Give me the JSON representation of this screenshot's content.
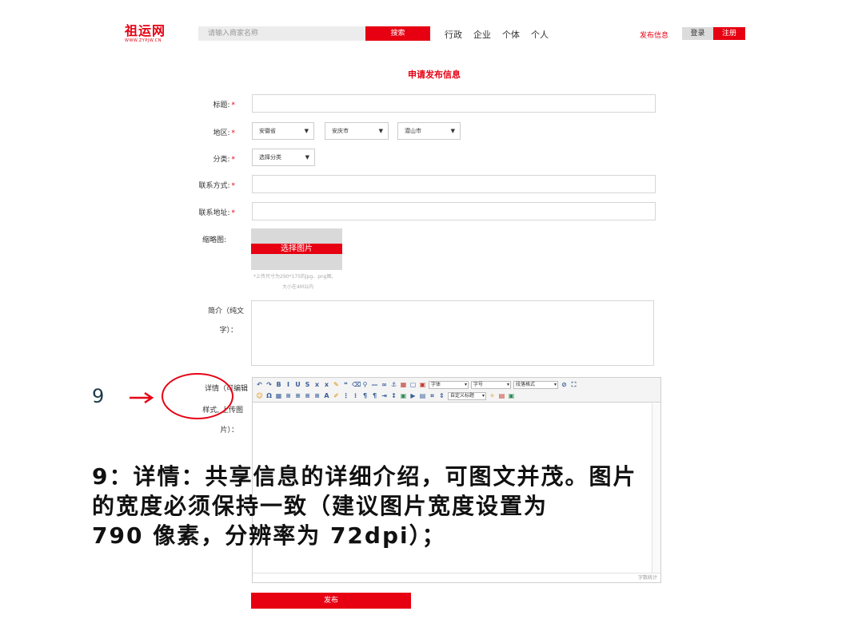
{
  "header": {
    "logo_title": "祖运网",
    "logo_url": "WWW.ZYPJW.CN",
    "search_placeholder": "请输入商家名称",
    "search_button": "搜索",
    "nav": [
      "行政",
      "企业",
      "个体",
      "个人"
    ],
    "publish_link": "发布信息",
    "login": "登录",
    "register": "注册"
  },
  "page_title": "申请发布信息",
  "form": {
    "title_label": "标题:",
    "region_label": "地区:",
    "region_province": "安徽省",
    "region_city": "安庆市",
    "region_county": "潜山市",
    "category_label": "分类:",
    "category_value": "选择分类",
    "contact_label": "联系方式:",
    "address_label": "联系地址:",
    "thumbnail_label": "缩略图:",
    "thumbnail_button": "选择图片",
    "thumbnail_hint_1": "*上传尺寸为290*175的jpg、png图,",
    "thumbnail_hint_2": "大小在4M以内",
    "summary_label_1": "简介（纯文",
    "summary_label_2": "字）：",
    "detail_label_1": "详情（可编辑",
    "detail_label_2": "样式, 上传图",
    "detail_label_3": "片）：",
    "required_mark": "*",
    "submit": "发布"
  },
  "editor": {
    "font_family": "字体",
    "font_size": "字号",
    "paragraph": "段落格式",
    "custom_title": "自定义标题",
    "word_count": "字数统计"
  },
  "annotation": {
    "number": "9",
    "caption_lines": [
      "9：详情：共享信息的详细介绍，可图文并茂。图片",
      "的宽度必须保持一致（建议图片宽度设置为",
      "790 像素，分辨率为 72dpi）；"
    ]
  },
  "colors": {
    "brand_red": "#e60012"
  }
}
